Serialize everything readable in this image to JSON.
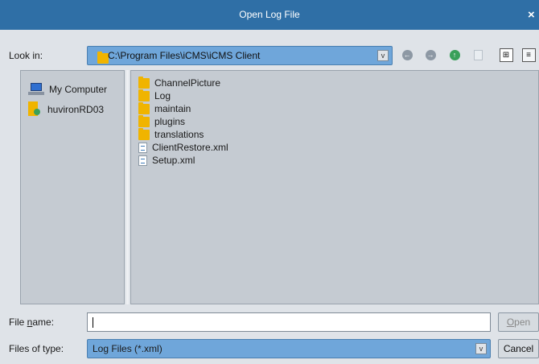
{
  "window": {
    "title": "Open Log File",
    "close_glyph": "×"
  },
  "toolbar": {
    "look_in_label": "Look in:",
    "path": "C:\\Program Files\\iCMS\\iCMS Client",
    "back_glyph": "←",
    "forward_glyph": "→",
    "up_glyph": "↑",
    "list_view_glyph": "⊞",
    "details_view_glyph": "≡"
  },
  "places": [
    {
      "label": "My Computer",
      "icon": "computer-icon"
    },
    {
      "label": "huvironRD03",
      "icon": "user-folder-icon"
    }
  ],
  "files": [
    {
      "label": "ChannelPicture",
      "icon": "folder-icon"
    },
    {
      "label": "Log",
      "icon": "folder-icon"
    },
    {
      "label": "maintain",
      "icon": "folder-icon"
    },
    {
      "label": "plugins",
      "icon": "folder-icon"
    },
    {
      "label": "translations",
      "icon": "folder-icon"
    },
    {
      "label": "ClientRestore.xml",
      "icon": "xml-file-icon"
    },
    {
      "label": "Setup.xml",
      "icon": "xml-file-icon"
    }
  ],
  "file_name": {
    "label_pre": "File ",
    "label_mnemonic": "n",
    "label_post": "ame:",
    "value": ""
  },
  "file_type": {
    "label": "Files of type:",
    "value": "Log Files (*.xml)"
  },
  "buttons": {
    "open_mnemonic": "O",
    "open_rest": "pen",
    "cancel": "Cancel"
  },
  "colors": {
    "titlebar": "#2f6fa6",
    "combo": "#6fa6da",
    "panel": "#c5cbd2",
    "folder": "#f0b400"
  }
}
